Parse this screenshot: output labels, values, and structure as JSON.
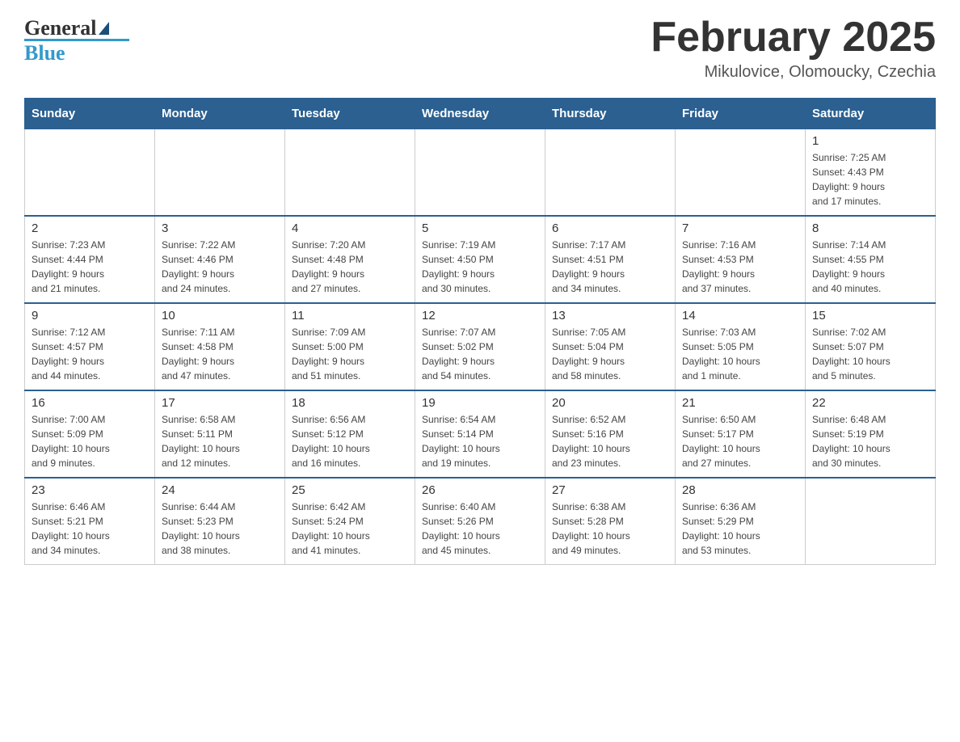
{
  "header": {
    "logo_line1": "General",
    "logo_line2": "Blue",
    "month_title": "February 2025",
    "location": "Mikulovice, Olomoucky, Czechia"
  },
  "weekdays": [
    "Sunday",
    "Monday",
    "Tuesday",
    "Wednesday",
    "Thursday",
    "Friday",
    "Saturday"
  ],
  "weeks": [
    [
      {
        "day": "",
        "info": ""
      },
      {
        "day": "",
        "info": ""
      },
      {
        "day": "",
        "info": ""
      },
      {
        "day": "",
        "info": ""
      },
      {
        "day": "",
        "info": ""
      },
      {
        "day": "",
        "info": ""
      },
      {
        "day": "1",
        "info": "Sunrise: 7:25 AM\nSunset: 4:43 PM\nDaylight: 9 hours\nand 17 minutes."
      }
    ],
    [
      {
        "day": "2",
        "info": "Sunrise: 7:23 AM\nSunset: 4:44 PM\nDaylight: 9 hours\nand 21 minutes."
      },
      {
        "day": "3",
        "info": "Sunrise: 7:22 AM\nSunset: 4:46 PM\nDaylight: 9 hours\nand 24 minutes."
      },
      {
        "day": "4",
        "info": "Sunrise: 7:20 AM\nSunset: 4:48 PM\nDaylight: 9 hours\nand 27 minutes."
      },
      {
        "day": "5",
        "info": "Sunrise: 7:19 AM\nSunset: 4:50 PM\nDaylight: 9 hours\nand 30 minutes."
      },
      {
        "day": "6",
        "info": "Sunrise: 7:17 AM\nSunset: 4:51 PM\nDaylight: 9 hours\nand 34 minutes."
      },
      {
        "day": "7",
        "info": "Sunrise: 7:16 AM\nSunset: 4:53 PM\nDaylight: 9 hours\nand 37 minutes."
      },
      {
        "day": "8",
        "info": "Sunrise: 7:14 AM\nSunset: 4:55 PM\nDaylight: 9 hours\nand 40 minutes."
      }
    ],
    [
      {
        "day": "9",
        "info": "Sunrise: 7:12 AM\nSunset: 4:57 PM\nDaylight: 9 hours\nand 44 minutes."
      },
      {
        "day": "10",
        "info": "Sunrise: 7:11 AM\nSunset: 4:58 PM\nDaylight: 9 hours\nand 47 minutes."
      },
      {
        "day": "11",
        "info": "Sunrise: 7:09 AM\nSunset: 5:00 PM\nDaylight: 9 hours\nand 51 minutes."
      },
      {
        "day": "12",
        "info": "Sunrise: 7:07 AM\nSunset: 5:02 PM\nDaylight: 9 hours\nand 54 minutes."
      },
      {
        "day": "13",
        "info": "Sunrise: 7:05 AM\nSunset: 5:04 PM\nDaylight: 9 hours\nand 58 minutes."
      },
      {
        "day": "14",
        "info": "Sunrise: 7:03 AM\nSunset: 5:05 PM\nDaylight: 10 hours\nand 1 minute."
      },
      {
        "day": "15",
        "info": "Sunrise: 7:02 AM\nSunset: 5:07 PM\nDaylight: 10 hours\nand 5 minutes."
      }
    ],
    [
      {
        "day": "16",
        "info": "Sunrise: 7:00 AM\nSunset: 5:09 PM\nDaylight: 10 hours\nand 9 minutes."
      },
      {
        "day": "17",
        "info": "Sunrise: 6:58 AM\nSunset: 5:11 PM\nDaylight: 10 hours\nand 12 minutes."
      },
      {
        "day": "18",
        "info": "Sunrise: 6:56 AM\nSunset: 5:12 PM\nDaylight: 10 hours\nand 16 minutes."
      },
      {
        "day": "19",
        "info": "Sunrise: 6:54 AM\nSunset: 5:14 PM\nDaylight: 10 hours\nand 19 minutes."
      },
      {
        "day": "20",
        "info": "Sunrise: 6:52 AM\nSunset: 5:16 PM\nDaylight: 10 hours\nand 23 minutes."
      },
      {
        "day": "21",
        "info": "Sunrise: 6:50 AM\nSunset: 5:17 PM\nDaylight: 10 hours\nand 27 minutes."
      },
      {
        "day": "22",
        "info": "Sunrise: 6:48 AM\nSunset: 5:19 PM\nDaylight: 10 hours\nand 30 minutes."
      }
    ],
    [
      {
        "day": "23",
        "info": "Sunrise: 6:46 AM\nSunset: 5:21 PM\nDaylight: 10 hours\nand 34 minutes."
      },
      {
        "day": "24",
        "info": "Sunrise: 6:44 AM\nSunset: 5:23 PM\nDaylight: 10 hours\nand 38 minutes."
      },
      {
        "day": "25",
        "info": "Sunrise: 6:42 AM\nSunset: 5:24 PM\nDaylight: 10 hours\nand 41 minutes."
      },
      {
        "day": "26",
        "info": "Sunrise: 6:40 AM\nSunset: 5:26 PM\nDaylight: 10 hours\nand 45 minutes."
      },
      {
        "day": "27",
        "info": "Sunrise: 6:38 AM\nSunset: 5:28 PM\nDaylight: 10 hours\nand 49 minutes."
      },
      {
        "day": "28",
        "info": "Sunrise: 6:36 AM\nSunset: 5:29 PM\nDaylight: 10 hours\nand 53 minutes."
      },
      {
        "day": "",
        "info": ""
      }
    ]
  ]
}
